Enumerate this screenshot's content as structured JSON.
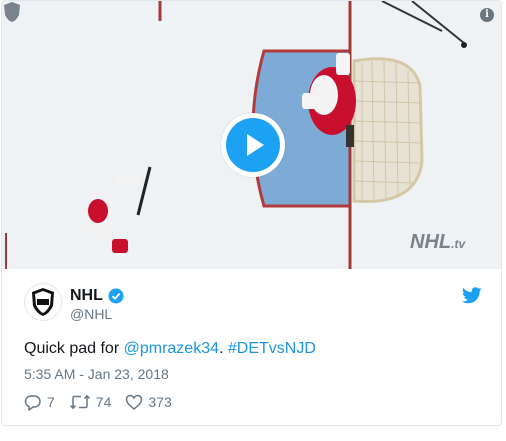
{
  "media": {
    "watermark_brand": "NHL",
    "watermark_suffix": ".tv",
    "play_label": "Play video",
    "info_label": "i"
  },
  "account": {
    "name": "NHL",
    "handle": "@NHL",
    "verified": true
  },
  "tweet": {
    "text_prefix": "Quick pad for ",
    "mention": "@pmrazek34",
    "text_mid": ". ",
    "hashtag": "#DETvsNJD",
    "timestamp": "5:35 AM - Jan 23, 2018"
  },
  "actions": {
    "replies": "7",
    "retweets": "74",
    "likes": "373"
  },
  "colors": {
    "accent": "#1da1f2",
    "link": "#1b95e0",
    "text": "#14171a",
    "muted": "#657786"
  }
}
